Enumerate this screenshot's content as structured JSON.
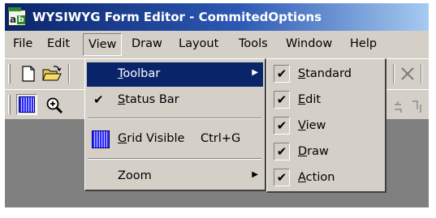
{
  "window": {
    "title": "WYSIWYG Form Editor - CommitedOptions",
    "icon": "form-editor-app-icon",
    "icon_letters": [
      "a",
      "b"
    ]
  },
  "menubar": {
    "items": [
      {
        "label": "File"
      },
      {
        "label": "Edit"
      },
      {
        "label": "View",
        "active": true
      },
      {
        "label": "Draw"
      },
      {
        "label": "Layout"
      },
      {
        "label": "Tools"
      },
      {
        "label": "Window"
      },
      {
        "label": "Help"
      }
    ]
  },
  "toolbar": {
    "icons": [
      "new-document-icon",
      "open-folder-icon",
      "delete-x-icon",
      "align-icon"
    ],
    "icons2": [
      "grid-icon",
      "zoom-in-icon"
    ]
  },
  "view_menu": {
    "items": [
      {
        "label": "Toolbar",
        "mnemonic": "T",
        "rest": "oolbar",
        "submenu": true,
        "highlighted": true
      },
      {
        "label": "Status Bar",
        "mnemonic": "S",
        "rest": "tatus Bar",
        "checked": true
      },
      {
        "label": "Grid Visible",
        "mnemonic": "G",
        "rest": "rid Visible",
        "shortcut": "Ctrl+G",
        "icon": "grid-icon"
      },
      {
        "label": "Zoom",
        "submenu": true
      }
    ]
  },
  "toolbar_submenu": {
    "items": [
      {
        "label": "Standard",
        "mnemonic": "S",
        "rest": "tandard",
        "checked": true
      },
      {
        "label": "Edit",
        "mnemonic": "E",
        "rest": "dit",
        "checked": true
      },
      {
        "label": "View",
        "mnemonic": "V",
        "rest": "iew",
        "checked": true
      },
      {
        "label": "Draw",
        "mnemonic": "D",
        "rest": "raw",
        "checked": true
      },
      {
        "label": "Action",
        "mnemonic": "A",
        "rest": "ction",
        "checked": true
      }
    ]
  },
  "colors": {
    "menu_bg": "#d4d0c8",
    "highlight": "#0a246a",
    "title_gradient_start": "#0a246a",
    "title_gradient_end": "#a6caf0",
    "workspace": "#808080"
  }
}
